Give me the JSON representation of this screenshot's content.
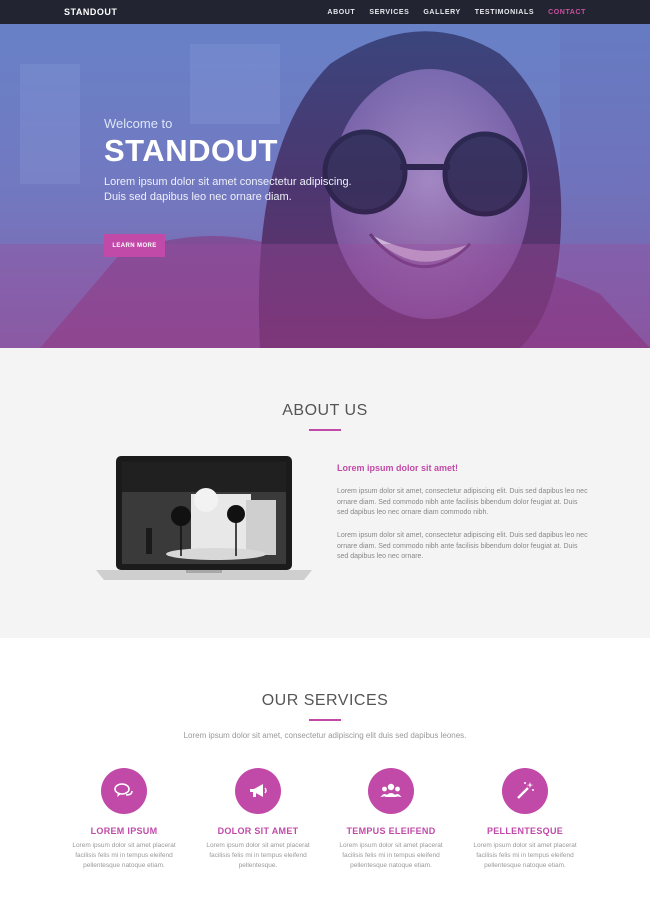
{
  "nav": {
    "brand": "STANDOUT",
    "links": [
      "ABOUT",
      "SERVICES",
      "GALLERY",
      "TESTIMONIALS",
      "CONTACT"
    ]
  },
  "hero": {
    "welcome": "Welcome to",
    "title": "STANDOUT",
    "subtitle": "Lorem ipsum dolor sit amet consectetur adipiscing. Duis sed dapibus leo nec ornare diam.",
    "button": "LEARN MORE"
  },
  "about": {
    "title": "ABOUT US",
    "heading": "Lorem ipsum dolor sit amet!",
    "para1": "Lorem ipsum dolor sit amet, consectetur adipiscing elit. Duis sed dapibus leo nec ornare diam. Sed commodo nibh ante facilisis bibendum dolor feugiat at. Duis sed dapibus leo nec ornare diam commodo nibh.",
    "para2": "Lorem ipsum dolor sit amet, consectetur adipiscing elit. Duis sed dapibus leo nec ornare diam. Sed commodo nibh ante facilisis bibendum dolor feugiat at. Duis sed dapibus leo nec ornare."
  },
  "services": {
    "title": "OUR SERVICES",
    "subtitle": "Lorem ipsum dolor sit amet, consectetur adipiscing elit duis sed dapibus leones.",
    "items": [
      {
        "title": "LOREM IPSUM",
        "text": "Lorem ipsum dolor sit amet placerat facilisis felis mi in tempus eleifend pellentesque natoque etiam.",
        "icon": "chat-bubbles-icon"
      },
      {
        "title": "DOLOR SIT AMET",
        "text": "Lorem ipsum dolor sit amet placerat facilisis felis mi in tempus eleifend pellentesque.",
        "icon": "megaphone-icon"
      },
      {
        "title": "TEMPUS ELEIFEND",
        "text": "Lorem ipsum dolor sit amet placerat facilisis felis mi in tempus eleifend pellentesque natoque etiam.",
        "icon": "users-icon"
      },
      {
        "title": "PELLENTESQUE",
        "text": "Lorem ipsum dolor sit amet placerat facilisis felis mi in tempus eleifend pellentesque natoque etiam.",
        "icon": "magic-wand-icon"
      }
    ]
  },
  "colors": {
    "accent": "#c14aa8",
    "navbar": "#222531",
    "about_bg": "#f4f4f4"
  }
}
